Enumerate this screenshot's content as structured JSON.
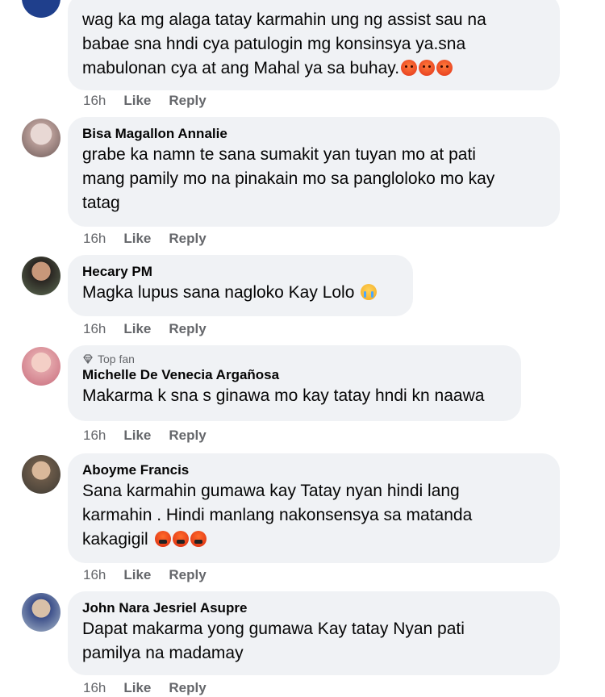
{
  "comments": [
    {
      "author": "",
      "lines": [
        "wag ka mg alaga tatay karmahin ung ng assist sau na",
        "babae sna hndi cya patulogin mg konsinsya ya.sna",
        "mabulonan cya at ang Mahal ya sa buhay."
      ],
      "emojis": [
        "angry-face-icon",
        "angry-face-icon",
        "angry-face-icon"
      ],
      "time": "16h",
      "like": "Like",
      "reply": "Reply"
    },
    {
      "author": "Bisa Magallon Annalie",
      "lines": [
        "grabe ka namn te sana sumakit yan tuyan mo at pati",
        "mang pamily mo na pinakain mo sa pangloloko mo kay",
        "tatag"
      ],
      "time": "16h",
      "like": "Like",
      "reply": "Reply"
    },
    {
      "author": "Hecary PM",
      "lines": [
        "Magka lupus sana nagloko Kay Lolo"
      ],
      "emojis": [
        "crying-face-icon"
      ],
      "time": "16h",
      "like": "Like",
      "reply": "Reply"
    },
    {
      "badge": "Top fan",
      "author": "Michelle De Venecia Argañosa",
      "lines": [
        "Makarma k sna s ginawa mo kay tatay hndi kn naawa"
      ],
      "time": "16h",
      "like": "Like",
      "reply": "Reply"
    },
    {
      "author": "Aboyme Francis",
      "lines": [
        "Sana karmahin gumawa kay Tatay nyan hindi lang",
        "karmahin . Hindi manlang nakonsensya sa matanda",
        "kakagigil"
      ],
      "emojis": [
        "cursing-face-icon",
        "cursing-face-icon",
        "cursing-face-icon"
      ],
      "time": "16h",
      "like": "Like",
      "reply": "Reply"
    },
    {
      "author": "John Nara Jesriel Asupre",
      "lines": [
        "Dapat makarma yong gumawa Kay tatay Nyan pati",
        "pamilya na madamay"
      ],
      "time": "16h",
      "like": "Like",
      "reply": "Reply"
    }
  ],
  "colors": {
    "bubble": "#f0f2f5",
    "meta": "#65676b",
    "text": "#050505"
  }
}
